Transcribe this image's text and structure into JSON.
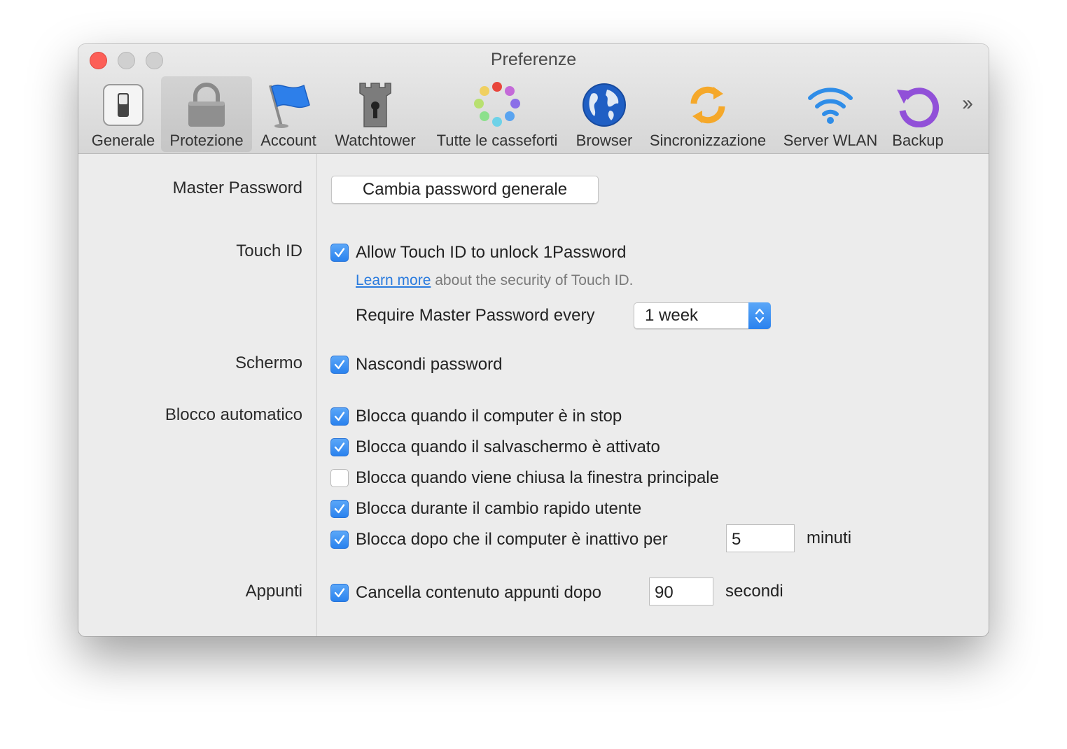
{
  "window": {
    "title": "Preferenze"
  },
  "toolbar": {
    "items": [
      {
        "label": "Generale",
        "icon": "switch-icon"
      },
      {
        "label": "Protezione",
        "icon": "lock-icon",
        "selected": true
      },
      {
        "label": "Account",
        "icon": "flag-icon"
      },
      {
        "label": "Watchtower",
        "icon": "tower-icon"
      },
      {
        "label": "Tutte le casseforti",
        "icon": "vaults-icon"
      },
      {
        "label": "Browser",
        "icon": "globe-icon"
      },
      {
        "label": "Sincronizzazione",
        "icon": "sync-icon"
      },
      {
        "label": "Server WLAN",
        "icon": "wifi-icon"
      },
      {
        "label": "Backup",
        "icon": "backup-icon"
      }
    ],
    "overflow_icon": "chevron-double-right-icon"
  },
  "master_password": {
    "label": "Master Password",
    "button": "Cambia password generale"
  },
  "touch_id": {
    "label": "Touch ID",
    "allow": {
      "text": "Allow Touch ID to unlock 1Password",
      "checked": true
    },
    "learn_more_link": "Learn more",
    "learn_more_rest": " about the security of Touch ID.",
    "require_label": "Require Master Password every",
    "require_value": "1 week"
  },
  "schermo": {
    "label": "Schermo",
    "hide": {
      "text": "Nascondi password",
      "checked": true
    }
  },
  "blocco": {
    "label": "Blocco automatico",
    "options": [
      {
        "text": "Blocca quando il computer è in stop",
        "checked": true
      },
      {
        "text": "Blocca quando il salvaschermo è attivato",
        "checked": true
      },
      {
        "text": "Blocca quando viene chiusa la finestra principale",
        "checked": false
      },
      {
        "text": "Blocca durante il cambio rapido utente",
        "checked": true
      },
      {
        "text": "Blocca dopo che il computer è inattivo per",
        "checked": true
      }
    ],
    "idle_minutes": "5",
    "idle_unit": "minuti"
  },
  "appunti": {
    "label": "Appunti",
    "clear": {
      "text": "Cancella contenuto appunti dopo",
      "checked": true
    },
    "seconds": "90",
    "unit": "secondi"
  },
  "colors": {
    "accent": "#2a82ee",
    "close": "#fc5f57",
    "window_bg": "#ececec"
  }
}
